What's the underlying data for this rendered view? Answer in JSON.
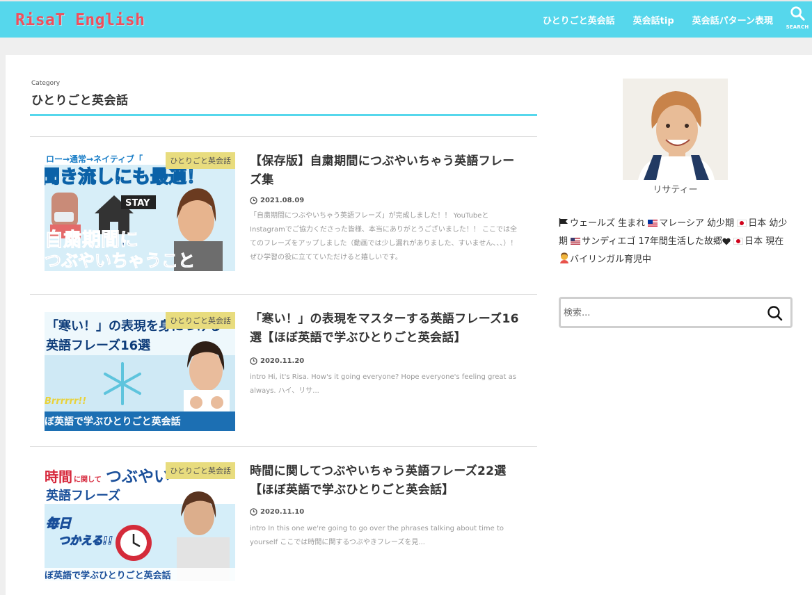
{
  "header": {
    "logo": "RisaT English",
    "nav": [
      "ひとりごと英会話",
      "英会話tip",
      "英会話パターン表現"
    ],
    "search_label": "SEARCH"
  },
  "category": {
    "sub": "Category",
    "title": "ひとりごと英会話"
  },
  "articles": [
    {
      "badge": "ひとりごと英会話",
      "title": "【保存版】自粛期間につぶやいちゃう英語フレーズ集",
      "date": "2021.08.09",
      "excerpt": "「自粛期間につぶやいちゃう英語フレーズ」が完成しました！！ YouTubeとInstagramでご協力くださった皆様、本当にありがとうございました！！ ここでは全てのフレーズをアップしました（動画では少し漏れがありました、すいません、、、）！ぜひ学習の役に立てていただけると嬉しいです。",
      "thumb_text": [
        "ロー→通常→ネイティブ「",
        "聞き流しにも最適！",
        "STAY",
        "自粛期間に",
        "つぶやいちゃうこと"
      ]
    },
    {
      "badge": "ひとりごと英会話",
      "title": "「寒い！」の表現をマスターする英語フレーズ16選【ほぼ英語で学ぶひとりごと英会話】",
      "date": "2020.11.20",
      "excerpt": "intro Hi, it's Risa. How's it going everyone? Hope everyone's feeling great as always. ハイ、リサ...",
      "thumb_text": [
        "「寒い！」の表現を身につける",
        "英語フレーズ16選",
        "Brrrrrr!!",
        "ぼ英語で学ぶひとりごと英会話"
      ]
    },
    {
      "badge": "ひとりごと英会話",
      "title": "時間に関してつぶやいちゃう英語フレーズ22選【ほぼ英語で学ぶひとりごと英会話】",
      "date": "2020.11.10",
      "excerpt": "intro In this one we're going to go over the phrases talking about time to yourself ここでは時間に関するつぶやきフレーズを見...",
      "thumb_text": [
        "時間",
        "に関して",
        "つぶやい",
        "英語フレーズ",
        "毎日",
        "つかえる!!",
        "ぼ英語で学ぶひとりごと英会話"
      ]
    }
  ],
  "sidebar": {
    "profile_name": "リサティー",
    "bio": {
      "wales": "ウェールズ 生まれ",
      "malaysia": "マレーシア 幼少期",
      "japan1": "日本 幼少期",
      "us": "サンディエゴ 17年間生活した故郷",
      "japan2": "日本 現在",
      "bilingual": "バイリンガル育児中"
    },
    "search_placeholder": "検索..."
  },
  "colors": {
    "header_bg": "#56d7ec",
    "logo": "#ef4f5d",
    "badge_bg": "#e8dc7e",
    "accent_line": "#56d7ec"
  }
}
